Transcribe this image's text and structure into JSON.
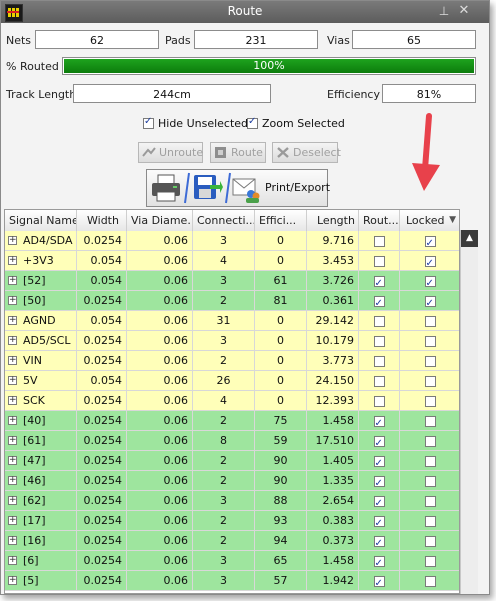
{
  "window": {
    "title": "Route",
    "pin_icon": "pin-icon",
    "close_icon": "close-icon"
  },
  "stats": {
    "nets_label": "Nets",
    "nets_value": "62",
    "pads_label": "Pads",
    "pads_value": "231",
    "vias_label": "Vias",
    "vias_value": "65",
    "routed_label": "% Routed",
    "routed_value": "100%",
    "routed_fraction": 1.0,
    "track_label": "Track Length",
    "track_value": "244cm",
    "efficiency_label": "Efficiency",
    "efficiency_value": "81%"
  },
  "options": {
    "hide_unselected_label": "Hide Unselected",
    "hide_unselected_checked": true,
    "zoom_selected_label": "Zoom Selected",
    "zoom_selected_checked": true
  },
  "toolbar": {
    "unroute_label": "Unroute",
    "route_label": "Route",
    "deselect_label": "Deselect",
    "print_export_label": "Print/Export"
  },
  "colors": {
    "green_row": "#9ee59e",
    "yellow_row": "#ffffb9",
    "progress": "#139013",
    "arrow": "#e8414b"
  },
  "grid": {
    "columns": [
      "Signal Name",
      "Width",
      "Via Diame...",
      "Connecti...",
      "Effici...",
      "Length",
      "Rout...",
      "Locked"
    ],
    "rows": [
      {
        "name": "AD4/SDA",
        "width": "0.0254",
        "via": "0.06",
        "conn": "3",
        "eff": "0",
        "length": "9.716",
        "routed": false,
        "locked": true,
        "color": "yellow"
      },
      {
        "name": "+3V3",
        "width": "0.054",
        "via": "0.06",
        "conn": "4",
        "eff": "0",
        "length": "3.453",
        "routed": false,
        "locked": true,
        "color": "yellow"
      },
      {
        "name": "[52]",
        "width": "0.054",
        "via": "0.06",
        "conn": "3",
        "eff": "61",
        "length": "3.726",
        "routed": true,
        "locked": true,
        "color": "green"
      },
      {
        "name": "[50]",
        "width": "0.0254",
        "via": "0.06",
        "conn": "2",
        "eff": "81",
        "length": "0.361",
        "routed": true,
        "locked": true,
        "color": "green"
      },
      {
        "name": "AGND",
        "width": "0.054",
        "via": "0.06",
        "conn": "31",
        "eff": "0",
        "length": "29.142",
        "routed": false,
        "locked": false,
        "color": "yellow"
      },
      {
        "name": "AD5/SCL",
        "width": "0.0254",
        "via": "0.06",
        "conn": "3",
        "eff": "0",
        "length": "10.179",
        "routed": false,
        "locked": false,
        "color": "yellow"
      },
      {
        "name": "VIN",
        "width": "0.0254",
        "via": "0.06",
        "conn": "2",
        "eff": "0",
        "length": "3.773",
        "routed": false,
        "locked": false,
        "color": "yellow"
      },
      {
        "name": "5V",
        "width": "0.054",
        "via": "0.06",
        "conn": "26",
        "eff": "0",
        "length": "24.150",
        "routed": false,
        "locked": false,
        "color": "yellow"
      },
      {
        "name": "SCK",
        "width": "0.0254",
        "via": "0.06",
        "conn": "4",
        "eff": "0",
        "length": "12.393",
        "routed": false,
        "locked": false,
        "color": "yellow"
      },
      {
        "name": "[40]",
        "width": "0.0254",
        "via": "0.06",
        "conn": "2",
        "eff": "75",
        "length": "1.458",
        "routed": true,
        "locked": false,
        "color": "green"
      },
      {
        "name": "[61]",
        "width": "0.0254",
        "via": "0.06",
        "conn": "8",
        "eff": "59",
        "length": "17.510",
        "routed": true,
        "locked": false,
        "color": "green"
      },
      {
        "name": "[47]",
        "width": "0.0254",
        "via": "0.06",
        "conn": "2",
        "eff": "90",
        "length": "1.405",
        "routed": true,
        "locked": false,
        "color": "green"
      },
      {
        "name": "[46]",
        "width": "0.0254",
        "via": "0.06",
        "conn": "2",
        "eff": "90",
        "length": "1.335",
        "routed": true,
        "locked": false,
        "color": "green"
      },
      {
        "name": "[62]",
        "width": "0.0254",
        "via": "0.06",
        "conn": "3",
        "eff": "88",
        "length": "2.654",
        "routed": true,
        "locked": false,
        "color": "green"
      },
      {
        "name": "[17]",
        "width": "0.0254",
        "via": "0.06",
        "conn": "2",
        "eff": "93",
        "length": "0.383",
        "routed": true,
        "locked": false,
        "color": "green"
      },
      {
        "name": "[16]",
        "width": "0.0254",
        "via": "0.06",
        "conn": "2",
        "eff": "94",
        "length": "0.373",
        "routed": true,
        "locked": false,
        "color": "green"
      },
      {
        "name": "[6]",
        "width": "0.0254",
        "via": "0.06",
        "conn": "3",
        "eff": "65",
        "length": "1.458",
        "routed": true,
        "locked": false,
        "color": "green"
      },
      {
        "name": "[5]",
        "width": "0.0254",
        "via": "0.06",
        "conn": "3",
        "eff": "57",
        "length": "1.942",
        "routed": true,
        "locked": false,
        "color": "green"
      }
    ]
  }
}
